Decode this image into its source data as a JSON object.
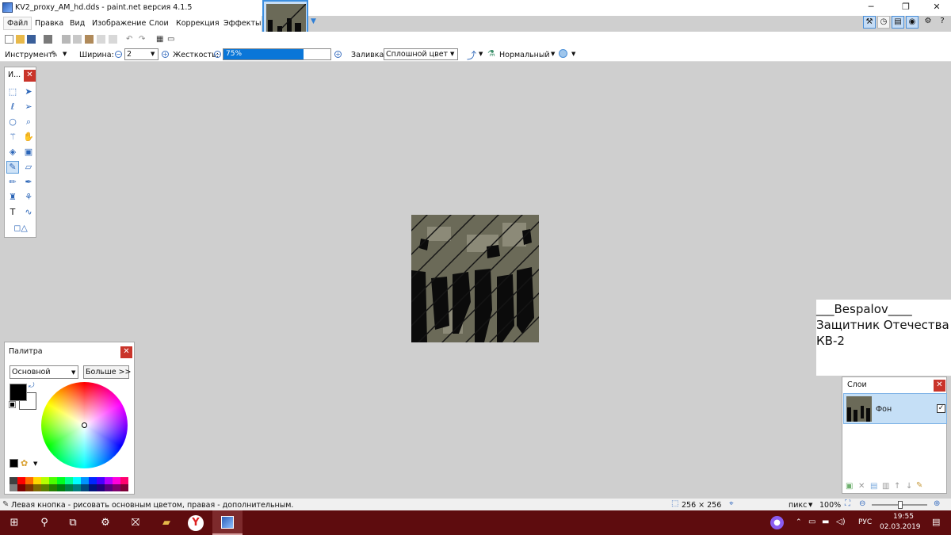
{
  "window": {
    "title": "KV2_proxy_AM_hd.dds - paint.net версия 4.1.5"
  },
  "menu": [
    {
      "label": "Файл"
    },
    {
      "label": "Правка"
    },
    {
      "label": "Вид"
    },
    {
      "label": "Изображение"
    },
    {
      "label": "Слои"
    },
    {
      "label": "Коррекция"
    },
    {
      "label": "Эффекты"
    }
  ],
  "toolbar": {
    "tool_label": "Инструмент:",
    "width_label": "Ширина:",
    "width_value": "2",
    "hardness_label": "Жесткость:",
    "hardness_value": "75%",
    "hardness_fraction": 0.75,
    "fill_label": "Заливка:",
    "fill_value": "Сплошной цвет",
    "blend_mode": "Нормальный"
  },
  "tools_panel": {
    "title": "И..."
  },
  "palette": {
    "title": "Палитра",
    "mode": "Основной",
    "more_button": "Больше >>",
    "primary_color": "#000000",
    "secondary_color": "#ffffff",
    "swatches_top": [
      "#404040",
      "#ff0000",
      "#ff6a00",
      "#ffd800",
      "#b6ff00",
      "#4cff00",
      "#00ff21",
      "#00ff90",
      "#00ffff",
      "#0094ff",
      "#0026ff",
      "#4800ff",
      "#b200ff",
      "#ff00dc",
      "#ff006e"
    ],
    "swatches_bottom": [
      "#808080",
      "#7f0000",
      "#7f3300",
      "#7f6a00",
      "#5b7f00",
      "#267f00",
      "#007f0e",
      "#007f46",
      "#007f7f",
      "#004a7f",
      "#00137f",
      "#21007f",
      "#57007f",
      "#7f006e",
      "#7f0037"
    ]
  },
  "annotation": {
    "line1": "___Bespalov____",
    "line2": "Защитник Отечества",
    "line3": "КВ-2"
  },
  "layers": {
    "title": "Слои",
    "items": [
      {
        "name": "Фон",
        "visible": true
      }
    ]
  },
  "status": {
    "hint": "Левая кнопка - рисовать основным цветом, правая - дополнительным.",
    "image_size": "256 × 256",
    "units": "пикс",
    "zoom": "100%"
  },
  "taskbar": {
    "language": "РУС",
    "time": "19:55",
    "date": "02.03.2019"
  }
}
